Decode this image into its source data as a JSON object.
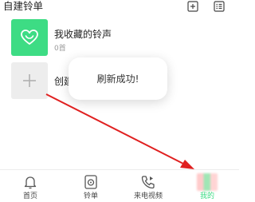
{
  "header": {
    "title": "自建铃单",
    "add_icon": "plus-square-icon",
    "manage_icon": "checklist-icon"
  },
  "lists": [
    {
      "title": "我收藏的铃声",
      "count": "0首",
      "icon": "heart-icon"
    },
    {
      "title": "创建",
      "icon": "plus-icon"
    }
  ],
  "toast": {
    "message": "刷新成功!"
  },
  "annotation": {
    "color": "#e02020"
  },
  "tabs": [
    {
      "label": "首页",
      "icon": "bell-icon"
    },
    {
      "label": "铃单",
      "icon": "music-disc-icon"
    },
    {
      "label": "来电视频",
      "icon": "phone-video-icon"
    },
    {
      "label": "我的",
      "icon": "profile-icon",
      "active": true
    }
  ],
  "colors": {
    "accent": "#3ddc84",
    "text": "#222222",
    "muted": "#999999"
  }
}
